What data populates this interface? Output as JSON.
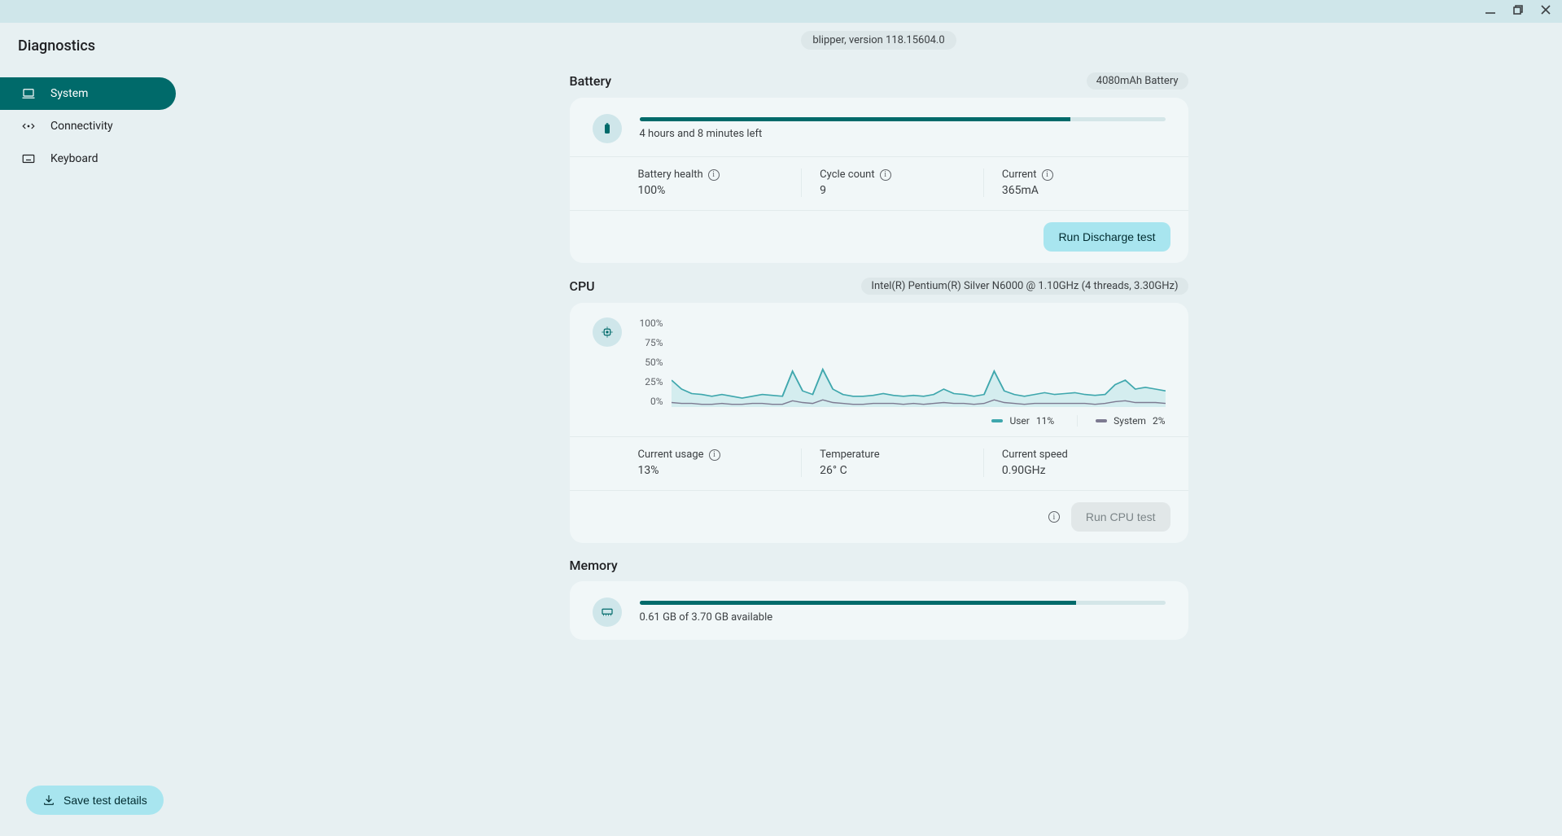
{
  "app": {
    "title": "Diagnostics"
  },
  "sidebar": {
    "items": [
      {
        "label": "System"
      },
      {
        "label": "Connectivity"
      },
      {
        "label": "Keyboard"
      }
    ],
    "save_label": "Save test details"
  },
  "version_chip": "blipper, version 118.15604.0",
  "battery": {
    "title": "Battery",
    "chip": "4080mAh Battery",
    "progress_pct": 82,
    "time_left": "4 hours and 8 minutes left",
    "health_label": "Battery health",
    "health_value": "100%",
    "cycle_label": "Cycle count",
    "cycle_value": "9",
    "current_label": "Current",
    "current_value": "365mA",
    "run_label": "Run Discharge test"
  },
  "cpu": {
    "title": "CPU",
    "chip": "Intel(R) Pentium(R) Silver N6000 @ 1.10GHz (4 threads, 3.30GHz)",
    "yticks": [
      "100%",
      "75%",
      "50%",
      "25%",
      "0%"
    ],
    "legend_user": "User",
    "legend_user_val": "11%",
    "legend_system": "System",
    "legend_system_val": "2%",
    "usage_label": "Current usage",
    "usage_value": "13%",
    "temp_label": "Temperature",
    "temp_value": "26° C",
    "speed_label": "Current speed",
    "speed_value": "0.90GHz",
    "run_label": "Run CPU test"
  },
  "memory": {
    "title": "Memory",
    "progress_pct": 83,
    "summary": "0.61 GB of 3.70 GB available"
  },
  "colors": {
    "user_line": "#3fa7ad",
    "user_fill": "#d4edef",
    "system_line": "#7d7a91"
  },
  "chart_data": {
    "type": "line",
    "ylim": [
      0,
      100
    ],
    "ylabel": "%",
    "x": [
      0,
      1,
      2,
      3,
      4,
      5,
      6,
      7,
      8,
      9,
      10,
      11,
      12,
      13,
      14,
      15,
      16,
      17,
      18,
      19,
      20,
      21,
      22,
      23,
      24,
      25,
      26,
      27,
      28,
      29,
      30,
      31,
      32,
      33,
      34,
      35,
      36,
      37,
      38,
      39,
      40,
      41,
      42,
      43,
      44,
      45,
      46,
      47,
      48,
      49
    ],
    "series": [
      {
        "name": "User",
        "values": [
          30,
          20,
          15,
          14,
          12,
          14,
          12,
          10,
          12,
          14,
          13,
          12,
          40,
          18,
          14,
          42,
          20,
          14,
          12,
          12,
          13,
          15,
          13,
          12,
          13,
          12,
          14,
          20,
          15,
          14,
          12,
          14,
          40,
          18,
          14,
          12,
          14,
          16,
          14,
          15,
          16,
          14,
          13,
          14,
          25,
          30,
          20,
          22,
          20,
          18
        ]
      },
      {
        "name": "System",
        "values": [
          5,
          4,
          4,
          3,
          3,
          4,
          3,
          3,
          4,
          4,
          3,
          3,
          7,
          5,
          4,
          8,
          5,
          4,
          3,
          3,
          4,
          4,
          4,
          3,
          4,
          3,
          4,
          5,
          4,
          4,
          3,
          4,
          8,
          5,
          4,
          3,
          4,
          4,
          4,
          4,
          4,
          4,
          3,
          4,
          6,
          7,
          5,
          5,
          5,
          4
        ]
      }
    ]
  }
}
